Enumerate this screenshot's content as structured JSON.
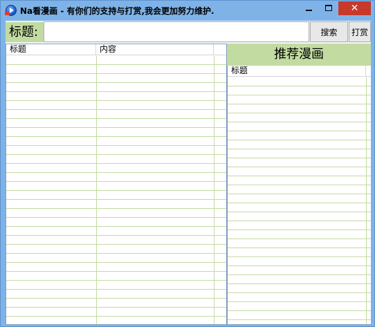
{
  "window": {
    "title": "Na看漫画 - 有你们的支持与打赏,我会更加努力维护.",
    "icon": "app-play-icon",
    "controls": {
      "minimize": "minimize-icon",
      "maximize": "maximize-icon",
      "close_glyph": "✕"
    }
  },
  "search": {
    "label": "标题:",
    "value": "",
    "search_button": "搜索",
    "donate_button": "打赏"
  },
  "results": {
    "columns": [
      "标题",
      "内容"
    ],
    "rows": []
  },
  "recommended": {
    "header": "推荐漫画",
    "columns": [
      "标题"
    ],
    "rows": []
  },
  "colors": {
    "titlebar": "#7fb3e8",
    "close_button": "#c7392b",
    "accent_green": "#c2dba1",
    "list_border": "#7f9db9"
  }
}
